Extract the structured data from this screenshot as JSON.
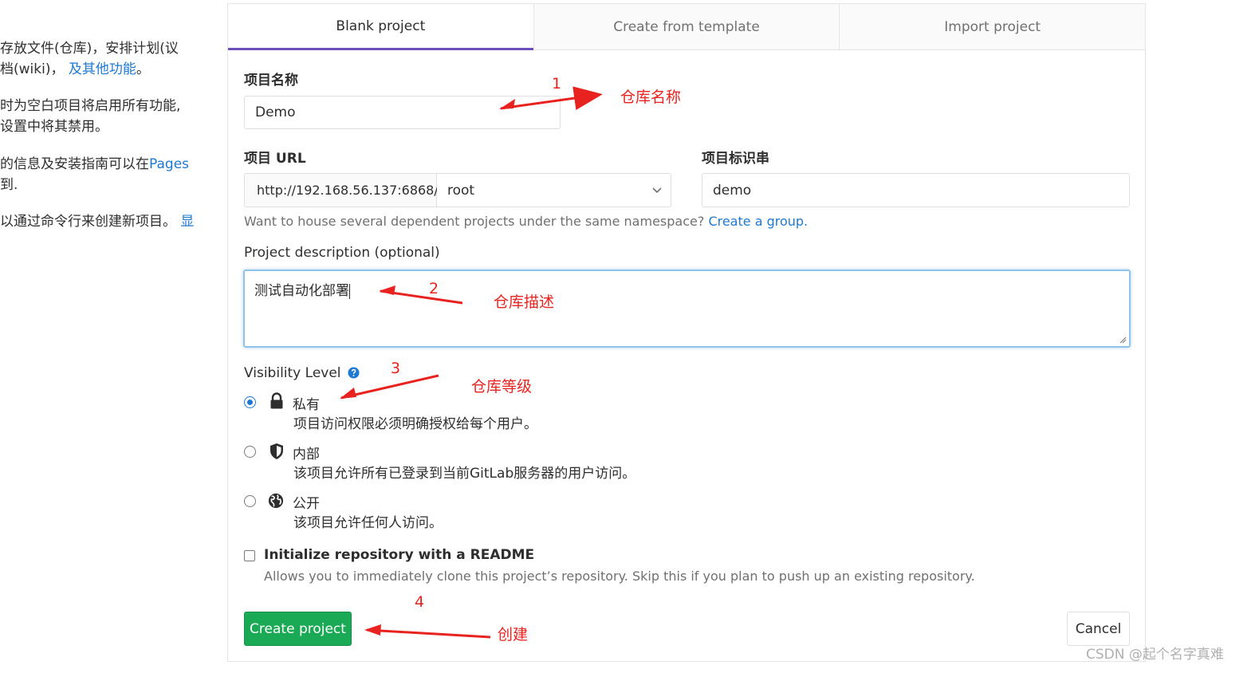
{
  "left_text": {
    "line1": "存放文件(仓库)，安排计划(议",
    "line2_prefix": "档(wiki)，",
    "line2_link": "及其他功能",
    "line2_suffix": "。",
    "line3": "时为空白项目将启用所有功能,",
    "line4": "设置中将其禁用。",
    "line5_prefix": "的信息及安装指南可以在",
    "line5_link": "Pages",
    "line6": "到.",
    "line7_prefix": "以通过命令行来创建新项目。",
    "line7_link": "显"
  },
  "tabs": [
    {
      "label": "Blank project"
    },
    {
      "label": "Create from template"
    },
    {
      "label": "Import project"
    }
  ],
  "form": {
    "project_name_label": "项目名称",
    "project_name_value": "Demo",
    "project_url_label": "项目 URL",
    "project_url_prefix": "http://192.168.56.137:6868/",
    "namespace_value": "root",
    "project_slug_label": "项目标识串",
    "project_slug_value": "demo",
    "group_help_text": "Want to house several dependent projects under the same namespace?",
    "group_help_link": "Create a group.",
    "description_label": "Project description (optional)",
    "description_value": "测试自动化部署",
    "visibility_label": "Visibility Level",
    "visibility_options": [
      {
        "title": "私有",
        "desc": "项目访问权限必须明确授权给每个用户。",
        "selected": true,
        "icon": "lock-icon"
      },
      {
        "title": "内部",
        "desc": "该项目允许所有已登录到当前GitLab服务器的用户访问。",
        "selected": false,
        "icon": "shield-icon"
      },
      {
        "title": "公开",
        "desc": "该项目允许任何人访问。",
        "selected": false,
        "icon": "globe-icon"
      }
    ],
    "readme_label": "Initialize repository with a README",
    "readme_help": "Allows you to immediately clone this project’s repository. Skip this if you plan to push up an existing repository.",
    "readme_checked": false,
    "create_button": "Create project",
    "cancel_button": "Cancel"
  },
  "annotations": [
    {
      "num": "1",
      "text": "仓库名称"
    },
    {
      "num": "2",
      "text": "仓库描述"
    },
    {
      "num": "3",
      "text": "仓库等级"
    },
    {
      "num": "4",
      "text": "创建"
    }
  ],
  "watermark": "CSDN @起个名字真难",
  "colors": {
    "accent_tab": "#6b4fbb",
    "link": "#1f78d1",
    "create_button": "#1aaa55",
    "annotation": "#e8231f"
  }
}
